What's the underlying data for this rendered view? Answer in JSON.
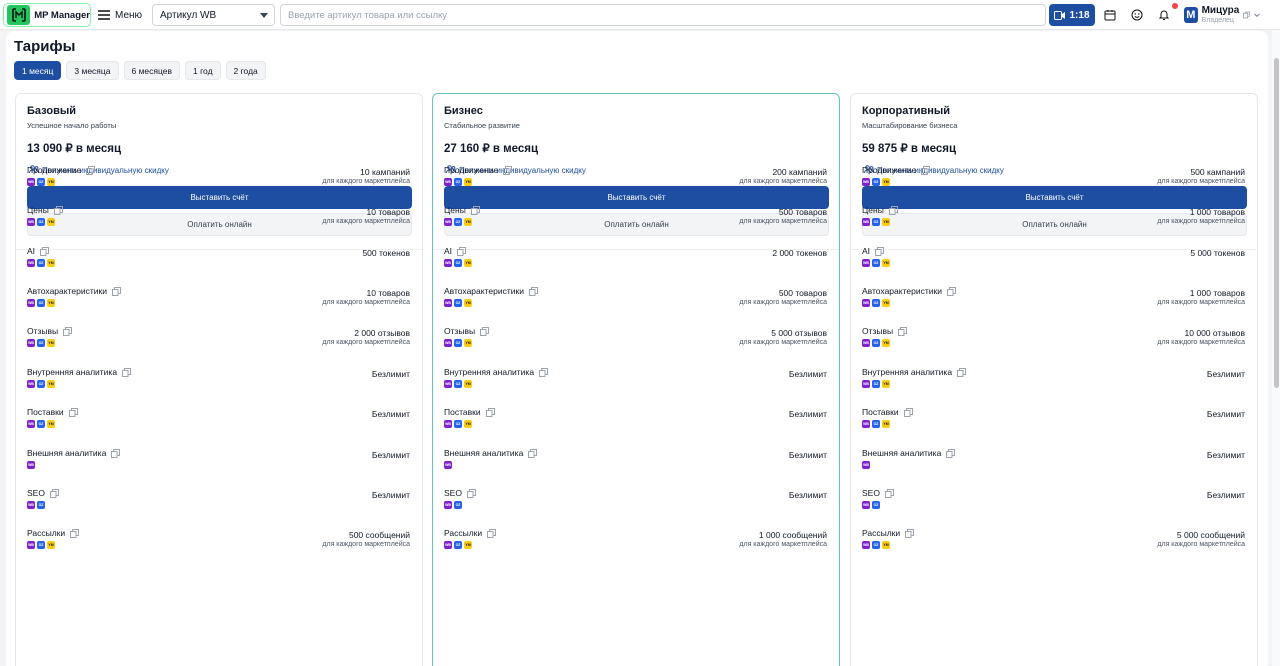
{
  "header": {
    "app_name": "MP Manager",
    "menu_label": "Меню",
    "marketplace_select": "Артикул WB",
    "search_placeholder": "Введите артикул товара или ссылку",
    "timer": "1:18",
    "user_initial": "M",
    "user_name": "Мицура",
    "user_role": "Владелец"
  },
  "page": {
    "title": "Тарифы",
    "periods": [
      "1 месяц",
      "3 месяца",
      "6 месяцев",
      "1 год",
      "2 года"
    ],
    "active_period": 0
  },
  "colors": {
    "primary": "#1d4ea1",
    "wb": "#7e22ce",
    "ozon": "#2563eb",
    "ym": "#facc15",
    "featured_border": "#67c4c6"
  },
  "plans": [
    {
      "name": "Базовый",
      "subtitle": "Успешное начало работы",
      "price": "13 090 ₽ в месяц",
      "discount": "Получить индивидуальную скидку",
      "invoice": "Выставить счёт",
      "online": "Оплатить онлайн",
      "features": [
        {
          "name": "Продвижение",
          "badges": [
            "WB",
            "OZ",
            "YM"
          ],
          "value": "10 кампаний",
          "note": "для каждого маркетплейса"
        },
        {
          "name": "Цены",
          "badges": [
            "WB",
            "OZ",
            "YM"
          ],
          "value": "10 товаров",
          "note": "для каждого маркетплейса"
        },
        {
          "name": "AI",
          "badges": [
            "WB",
            "OZ",
            "YM"
          ],
          "value": "500 токенов",
          "note": ""
        },
        {
          "name": "Автохарактеристики",
          "badges": [
            "WB",
            "OZ",
            "YM"
          ],
          "value": "10 товаров",
          "note": "для каждого маркетплейса"
        },
        {
          "name": "Отзывы",
          "badges": [
            "WB",
            "OZ",
            "YM"
          ],
          "value": "2 000 отзывов",
          "note": "для каждого маркетплейса"
        },
        {
          "name": "Внутренняя аналитика",
          "badges": [
            "WB",
            "OZ",
            "YM"
          ],
          "value": "Безлимит",
          "note": ""
        },
        {
          "name": "Поставки",
          "badges": [
            "WB",
            "OZ",
            "YM"
          ],
          "value": "Безлимит",
          "note": ""
        },
        {
          "name": "Внешняя аналитика",
          "badges": [
            "WB"
          ],
          "value": "Безлимит",
          "note": ""
        },
        {
          "name": "SEO",
          "badges": [
            "WB",
            "OZ"
          ],
          "value": "Безлимит",
          "note": ""
        },
        {
          "name": "Рассылки",
          "badges": [
            "WB",
            "OZ",
            "YM"
          ],
          "value": "500 сообщений",
          "note": "для каждого маркетплейса"
        }
      ]
    },
    {
      "name": "Бизнес",
      "subtitle": "Стабильное развитие",
      "price": "27 160 ₽ в месяц",
      "discount": "Получить индивидуальную скидку",
      "invoice": "Выставить счёт",
      "online": "Оплатить онлайн",
      "features": [
        {
          "name": "Продвижение",
          "badges": [
            "WB",
            "OZ",
            "YM"
          ],
          "value": "200 кампаний",
          "note": "для каждого маркетплейса"
        },
        {
          "name": "Цены",
          "badges": [
            "WB",
            "OZ",
            "YM"
          ],
          "value": "500 товаров",
          "note": "для каждого маркетплейса"
        },
        {
          "name": "AI",
          "badges": [
            "WB",
            "OZ",
            "YM"
          ],
          "value": "2 000 токенов",
          "note": ""
        },
        {
          "name": "Автохарактеристики",
          "badges": [
            "WB",
            "OZ",
            "YM"
          ],
          "value": "500 товаров",
          "note": "для каждого маркетплейса"
        },
        {
          "name": "Отзывы",
          "badges": [
            "WB",
            "OZ",
            "YM"
          ],
          "value": "5 000 отзывов",
          "note": "для каждого маркетплейса"
        },
        {
          "name": "Внутренняя аналитика",
          "badges": [
            "WB",
            "OZ",
            "YM"
          ],
          "value": "Безлимит",
          "note": ""
        },
        {
          "name": "Поставки",
          "badges": [
            "WB",
            "OZ",
            "YM"
          ],
          "value": "Безлимит",
          "note": ""
        },
        {
          "name": "Внешняя аналитика",
          "badges": [
            "WB"
          ],
          "value": "Безлимит",
          "note": ""
        },
        {
          "name": "SEO",
          "badges": [
            "WB",
            "OZ"
          ],
          "value": "Безлимит",
          "note": ""
        },
        {
          "name": "Рассылки",
          "badges": [
            "WB",
            "OZ",
            "YM"
          ],
          "value": "1 000 сообщений",
          "note": "для каждого маркетплейса"
        }
      ]
    },
    {
      "name": "Корпоративный",
      "subtitle": "Масштабирование бизнеса",
      "price": "59 875 ₽ в месяц",
      "discount": "Получить индивидуальную скидку",
      "invoice": "Выставить счёт",
      "online": "Оплатить онлайн",
      "features": [
        {
          "name": "Продвижение",
          "badges": [
            "WB",
            "OZ",
            "YM"
          ],
          "value": "500 кампаний",
          "note": "для каждого маркетплейса"
        },
        {
          "name": "Цены",
          "badges": [
            "WB",
            "OZ",
            "YM"
          ],
          "value": "1 000 товаров",
          "note": "для каждого маркетплейса"
        },
        {
          "name": "AI",
          "badges": [
            "WB",
            "OZ",
            "YM"
          ],
          "value": "5 000 токенов",
          "note": ""
        },
        {
          "name": "Автохарактеристики",
          "badges": [
            "WB",
            "OZ",
            "YM"
          ],
          "value": "1 000 товаров",
          "note": "для каждого маркетплейса"
        },
        {
          "name": "Отзывы",
          "badges": [
            "WB",
            "OZ",
            "YM"
          ],
          "value": "10 000 отзывов",
          "note": "для каждого маркетплейса"
        },
        {
          "name": "Внутренняя аналитика",
          "badges": [
            "WB",
            "OZ",
            "YM"
          ],
          "value": "Безлимит",
          "note": ""
        },
        {
          "name": "Поставки",
          "badges": [
            "WB",
            "OZ",
            "YM"
          ],
          "value": "Безлимит",
          "note": ""
        },
        {
          "name": "Внешняя аналитика",
          "badges": [
            "WB"
          ],
          "value": "Безлимит",
          "note": ""
        },
        {
          "name": "SEO",
          "badges": [
            "WB",
            "OZ"
          ],
          "value": "Безлимит",
          "note": ""
        },
        {
          "name": "Рассылки",
          "badges": [
            "WB",
            "OZ",
            "YM"
          ],
          "value": "5 000 сообщений",
          "note": "для каждого маркетплейса"
        }
      ]
    }
  ]
}
